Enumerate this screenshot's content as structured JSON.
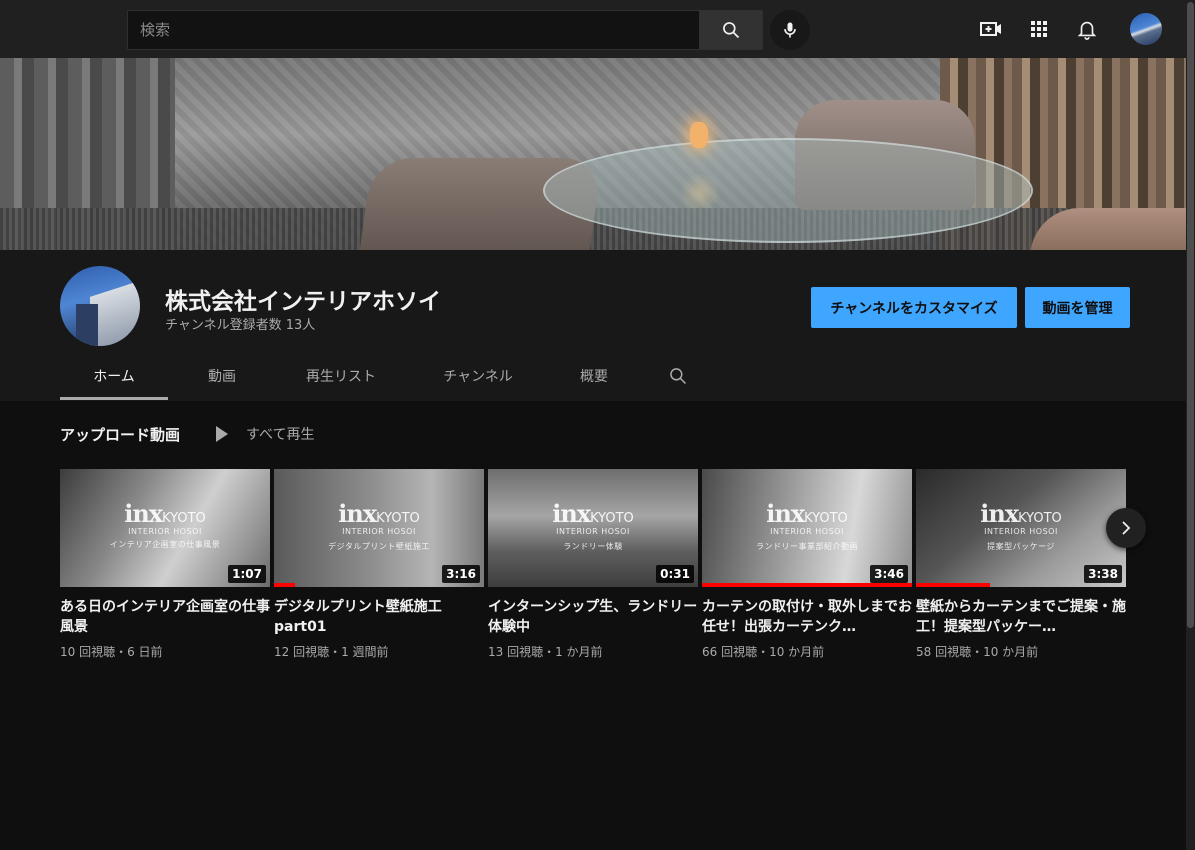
{
  "search": {
    "placeholder": "検索"
  },
  "channel": {
    "name": "株式会社インテリアホソイ",
    "subscribers": "チャンネル登録者数 13人",
    "customize_label": "チャンネルをカスタマイズ",
    "manage_label": "動画を管理"
  },
  "tabs": [
    {
      "label": "ホーム",
      "active": true
    },
    {
      "label": "動画"
    },
    {
      "label": "再生リスト"
    },
    {
      "label": "チャンネル"
    },
    {
      "label": "概要"
    }
  ],
  "uploads": {
    "title": "アップロード動画",
    "play_all": "すべて再生",
    "videos": [
      {
        "title": "ある日のインテリア企画室の仕事風景",
        "duration": "1:07",
        "meta": "10 回視聴・6 日前",
        "watched": 0,
        "caption": "インテリア企画室の仕事風景"
      },
      {
        "title": "デジタルプリント壁紙施工 part01",
        "duration": "3:16",
        "meta": "12 回視聴・1 週間前",
        "watched": 0.1,
        "caption": "デジタルプリント壁紙施工"
      },
      {
        "title": "インターンシップ生、ランドリー体験中",
        "duration": "0:31",
        "meta": "13 回視聴・1 か月前",
        "watched": 0,
        "caption": "ランドリー体験"
      },
      {
        "title": "カーテンの取付け・取外しまでお任せ！出張カーテンク…",
        "duration": "3:46",
        "meta": "66 回視聴・10 か月前",
        "watched": 1.0,
        "caption": "ランドリー事業部紹介動画"
      },
      {
        "title": "壁紙からカーテンまでご提案・施工！提案型パッケー…",
        "duration": "3:38",
        "meta": "58 回視聴・10 か月前",
        "watched": 0.35,
        "caption": "提案型パッケージ"
      }
    ]
  },
  "watermark": {
    "brand": "inx",
    "city": "KYOTO",
    "sub": "INTERIOR HOSOI"
  },
  "colors": {
    "accent": "#3ea6ff",
    "progress": "#ff0000",
    "background": "#0f0f0f"
  }
}
